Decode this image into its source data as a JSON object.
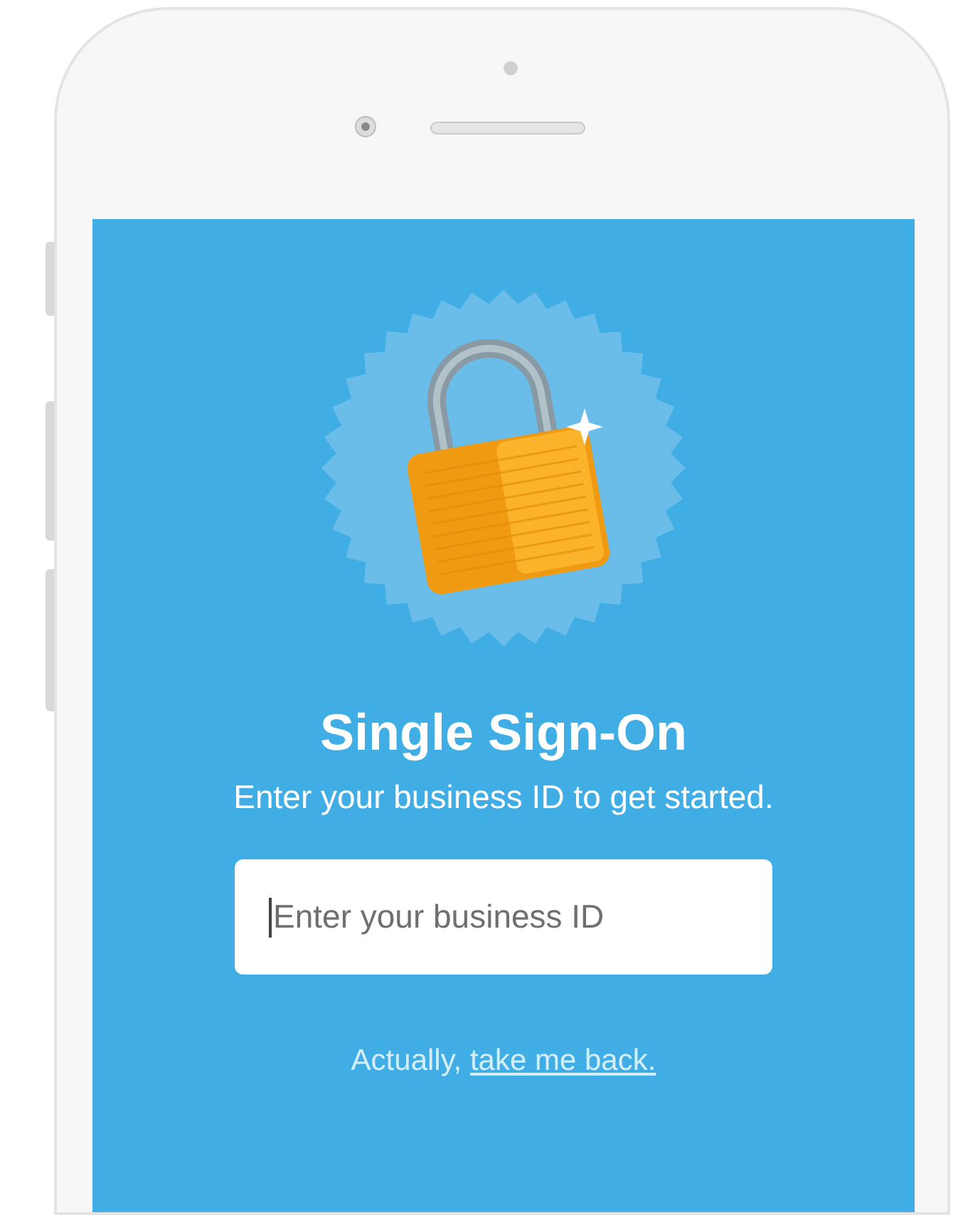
{
  "title": "Single Sign-On",
  "subtitle": "Enter your business ID to get started.",
  "business_id_field": {
    "placeholder": "Enter your business ID"
  },
  "back_prompt": {
    "text": "Actually,",
    "link": "take me back."
  }
}
